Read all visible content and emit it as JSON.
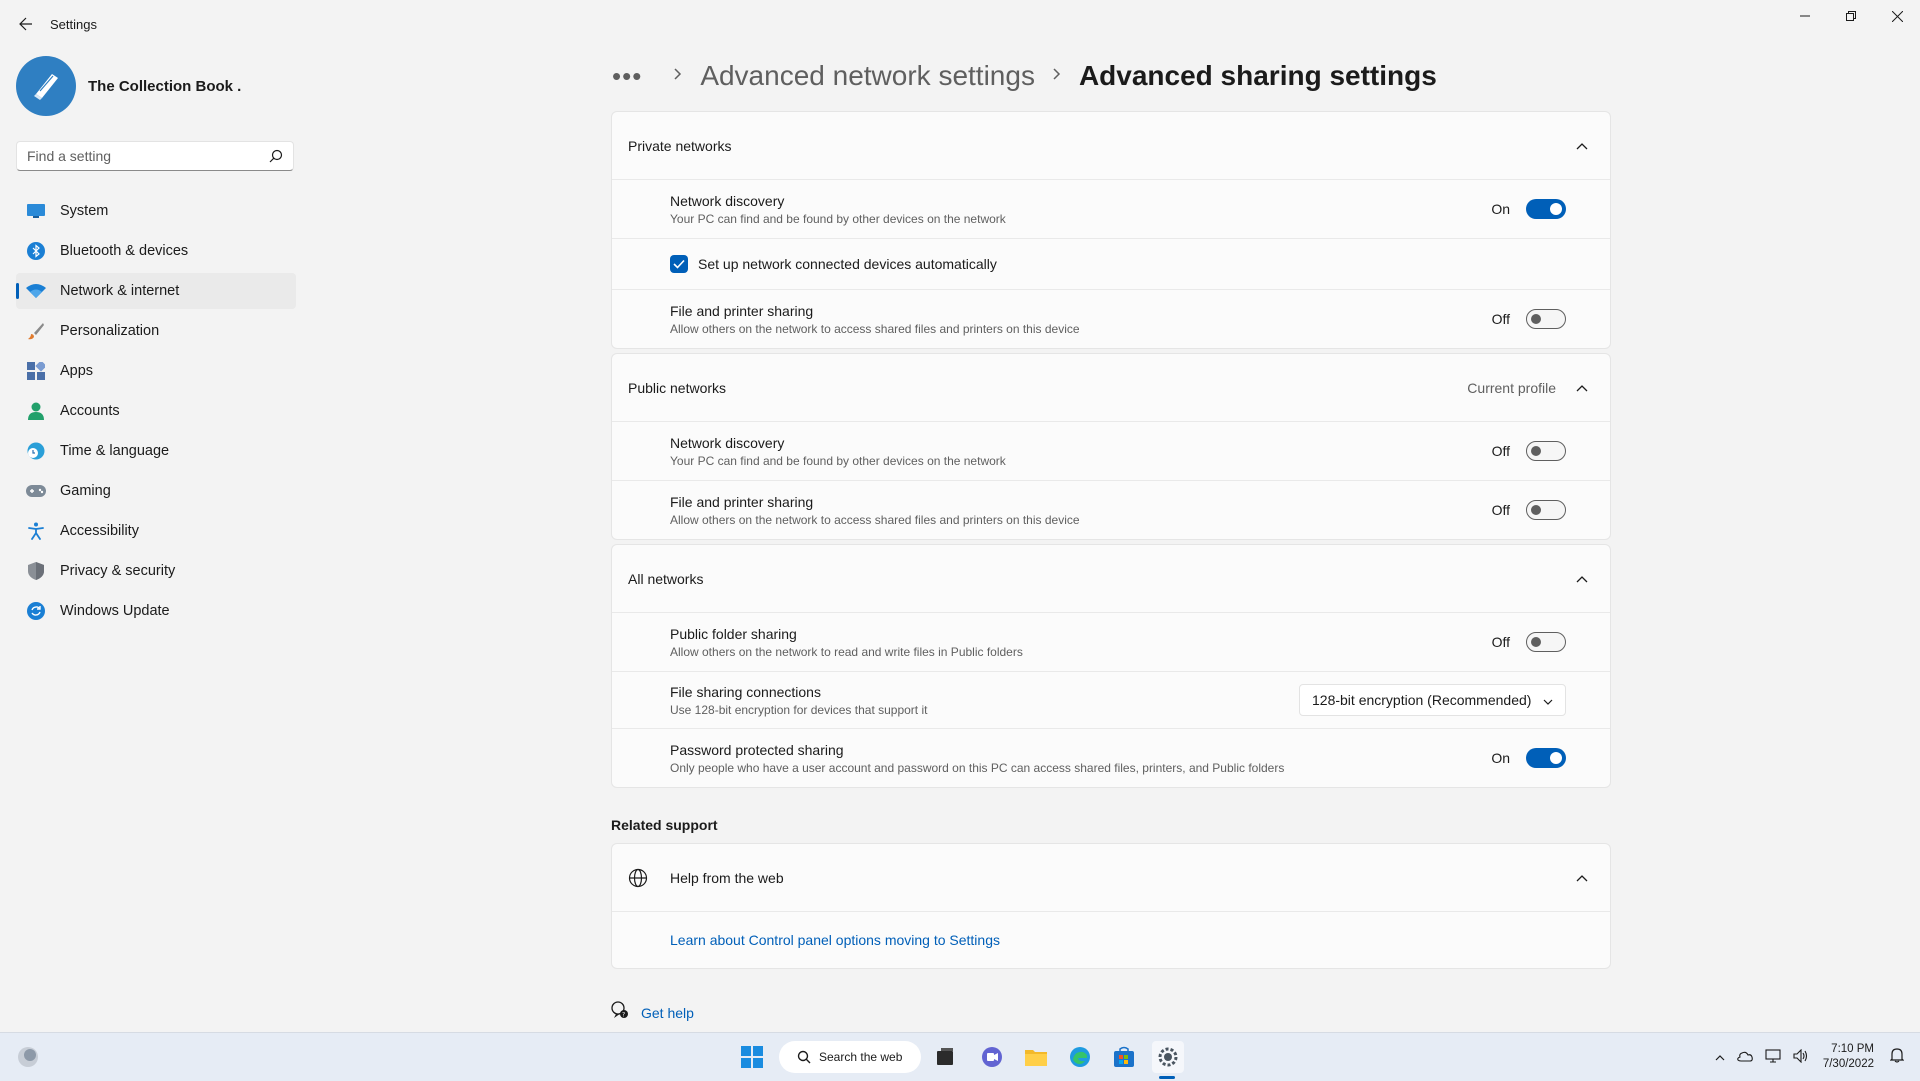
{
  "window": {
    "app_title": "Settings"
  },
  "profile": {
    "name": "The Collection Book ."
  },
  "search": {
    "placeholder": "Find a setting"
  },
  "sidebar": {
    "items": [
      {
        "label": "System",
        "icon": "monitor-icon"
      },
      {
        "label": "Bluetooth & devices",
        "icon": "bluetooth-icon"
      },
      {
        "label": "Network & internet",
        "icon": "wifi-icon",
        "active": true
      },
      {
        "label": "Personalization",
        "icon": "brush-icon"
      },
      {
        "label": "Apps",
        "icon": "apps-icon"
      },
      {
        "label": "Accounts",
        "icon": "person-icon"
      },
      {
        "label": "Time & language",
        "icon": "globe-clock-icon"
      },
      {
        "label": "Gaming",
        "icon": "gamepad-icon"
      },
      {
        "label": "Accessibility",
        "icon": "accessibility-icon"
      },
      {
        "label": "Privacy & security",
        "icon": "shield-icon"
      },
      {
        "label": "Windows Update",
        "icon": "update-icon"
      }
    ]
  },
  "breadcrumb": {
    "more": "•••",
    "parent": "Advanced network settings",
    "current": "Advanced sharing settings"
  },
  "private": {
    "title": "Private networks",
    "discovery": {
      "title": "Network discovery",
      "desc": "Your PC can find and be found by other devices on the network",
      "state": "On"
    },
    "auto_setup": {
      "label": "Set up network connected devices automatically",
      "checked": true
    },
    "printer": {
      "title": "File and printer sharing",
      "desc": "Allow others on the network to access shared files and printers on this device",
      "state": "Off"
    }
  },
  "public": {
    "title": "Public networks",
    "badge": "Current profile",
    "discovery": {
      "title": "Network discovery",
      "desc": "Your PC can find and be found by other devices on the network",
      "state": "Off"
    },
    "printer": {
      "title": "File and printer sharing",
      "desc": "Allow others on the network to access shared files and printers on this device",
      "state": "Off"
    }
  },
  "all": {
    "title": "All networks",
    "folder": {
      "title": "Public folder sharing",
      "desc": "Allow others on the network to read and write files in Public folders",
      "state": "Off"
    },
    "connections": {
      "title": "File sharing connections",
      "desc": "Use 128-bit encryption for devices that support it",
      "value": "128-bit encryption (Recommended)"
    },
    "password": {
      "title": "Password protected sharing",
      "desc": "Only people who have a user account and password on this PC can access shared files, printers, and Public folders",
      "state": "On"
    }
  },
  "related": {
    "title": "Related support",
    "help_title": "Help from the web",
    "link": "Learn about Control panel options moving to Settings"
  },
  "get_help": "Get help",
  "taskbar": {
    "search_label": "Search the web",
    "time": "7:10 PM",
    "date": "7/30/2022"
  },
  "colors": {
    "accent": "#005fb8",
    "background": "#f3f3f3",
    "card": "#fbfbfb"
  }
}
